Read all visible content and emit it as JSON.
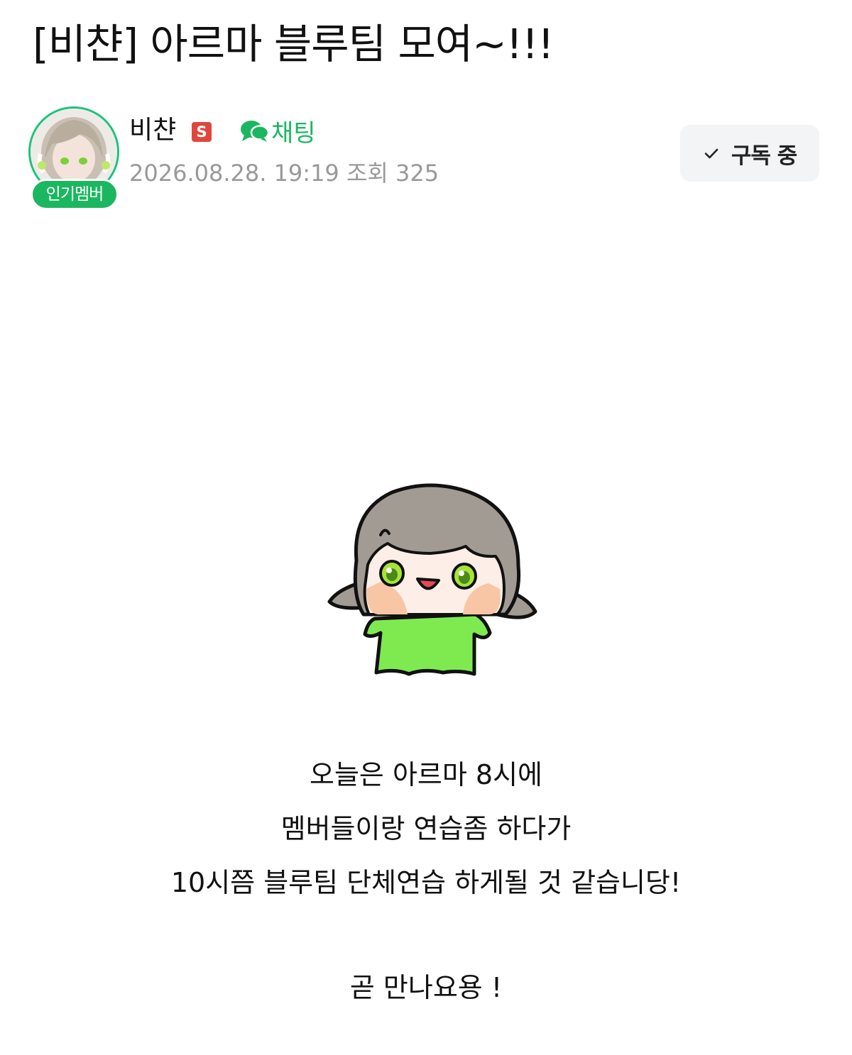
{
  "post": {
    "title": "[비챤] 아르마 블루팀 모여~!!!",
    "author": {
      "name": "비챤",
      "staff_badge": "S",
      "member_badge": "인기멤버",
      "chat_label": "채팅"
    },
    "meta": "2026.08.28. 19:19  조회 325",
    "subscribe_label": "구독 중",
    "body_lines": [
      "오늘은 아르마 8시에",
      "멤버들이랑 연습좀 하다가",
      "10시쯤 블루팀 단체연습 하게될 것 같습니당!",
      "",
      "곧 만나요용 !"
    ]
  },
  "colors": {
    "accent_green": "#1bb760",
    "staff_red": "#e0463e",
    "meta_gray": "#999999",
    "sticker_shirt": "#7eea50"
  },
  "icons": {
    "chat": "speech-bubbles-icon",
    "subscribe": "check-icon",
    "staff": "staff-s-icon"
  }
}
